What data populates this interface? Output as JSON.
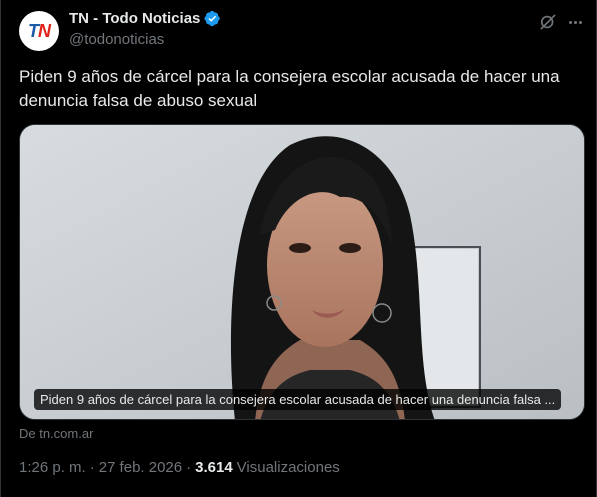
{
  "account": {
    "avatar_text_t": "T",
    "avatar_text_n": "N",
    "display_name": "TN - Todo Noticias",
    "handle": "@todonoticias",
    "verified": true
  },
  "tweet": {
    "text": "Piden 9 años de cárcel para la consejera escolar acusada de hacer una denuncia falsa de abuso sexual"
  },
  "card": {
    "caption": "Piden 9 años de cárcel para la consejera escolar acusada de hacer una denuncia falsa ...",
    "source": "De tn.com.ar"
  },
  "meta": {
    "time": "1:26 p. m.",
    "separator": "·",
    "date": "27 feb. 2026",
    "separator2": "·",
    "views_count": "3.614",
    "views_label": "Visualizaciones"
  },
  "icons": {
    "grok": "grok-icon",
    "more": "more-icon",
    "verified": "verified-badge-icon"
  },
  "colors": {
    "background": "#000000",
    "text": "#e7e9ea",
    "secondary": "#71767b",
    "verified": "#1d9bf0",
    "border": "#2f3336"
  }
}
